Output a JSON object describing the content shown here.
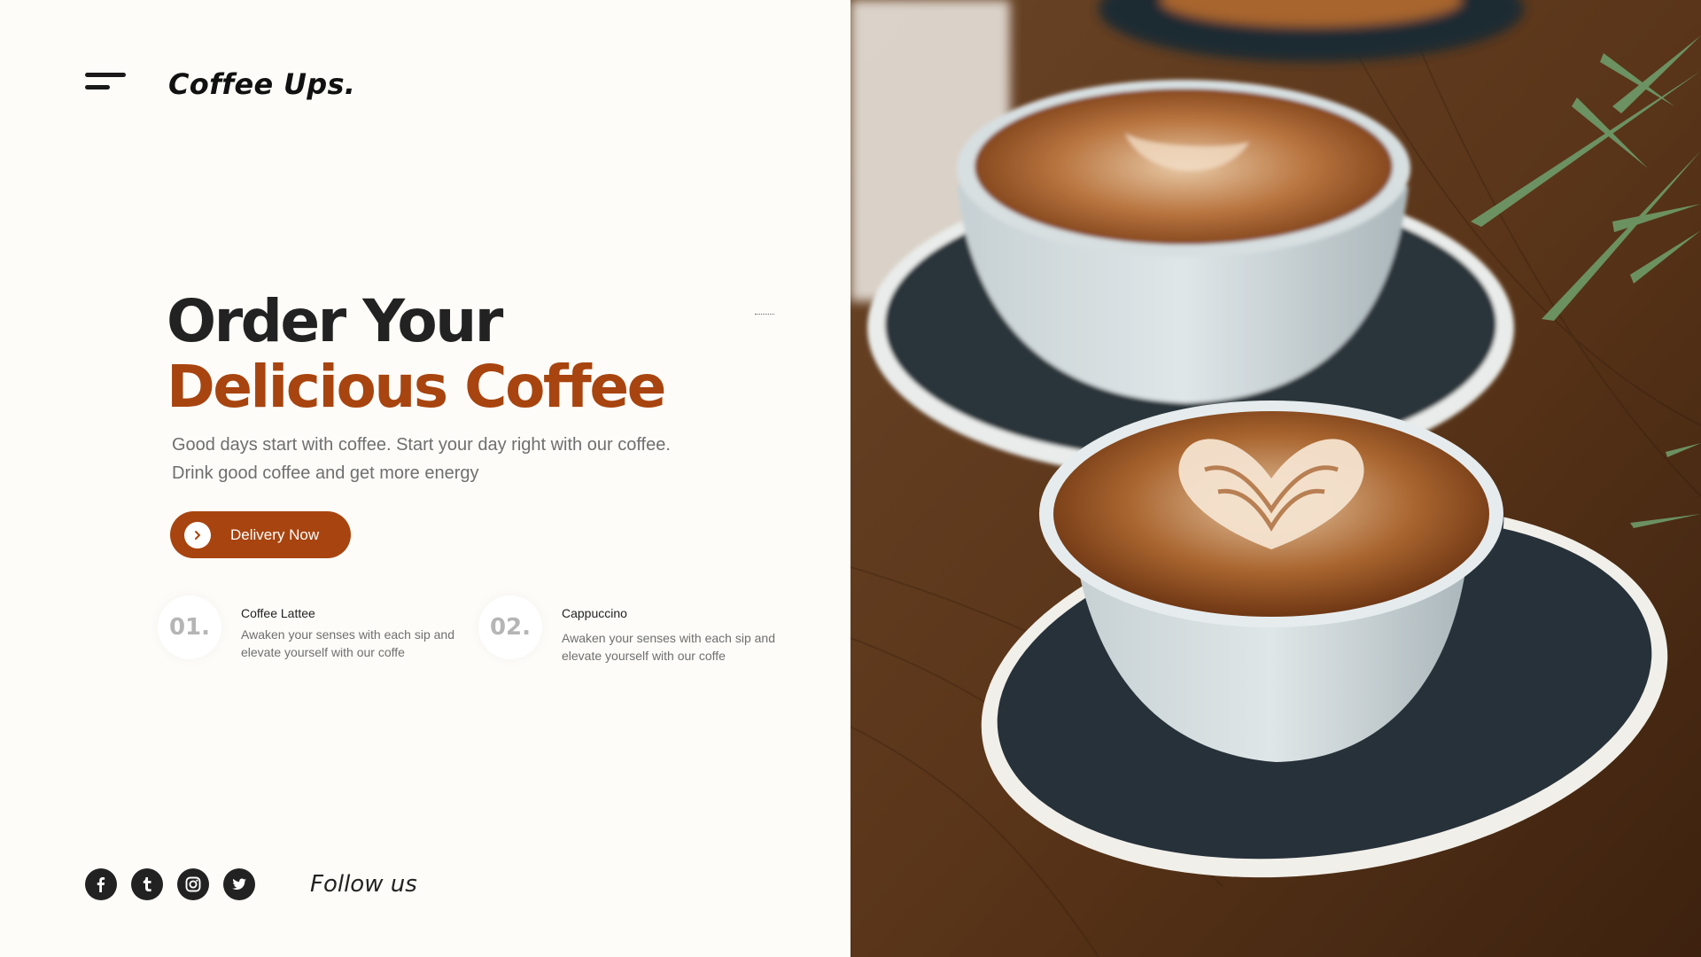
{
  "brand": {
    "name": "Coffee Ups."
  },
  "hero": {
    "title_line1": "Order Your",
    "title_line2": "Delicious Coffee",
    "subtitle_line1": "Good days start with coffee. Start your day right with our coffee.",
    "subtitle_line2": "Drink good coffee and get more energy",
    "cta_label": "Delivery Now"
  },
  "features": [
    {
      "number": "01.",
      "title": "Coffee Lattee",
      "description": "Awaken your senses with each sip and elevate yourself with our coffe"
    },
    {
      "number": "02.",
      "title": "Cappuccino",
      "description": "Awaken your senses with each sip and elevate yourself with our coffe"
    }
  ],
  "social": {
    "icons": [
      "facebook-icon",
      "tumblr-icon",
      "instagram-icon",
      "twitter-icon"
    ],
    "follow_label": "Follow us"
  },
  "colors": {
    "accent": "#a8440f",
    "background": "#fdfcf8",
    "dark": "#222222",
    "muted_text": "#6f6f6f"
  },
  "photo": {
    "subject": "latte-art-cups-photo"
  }
}
